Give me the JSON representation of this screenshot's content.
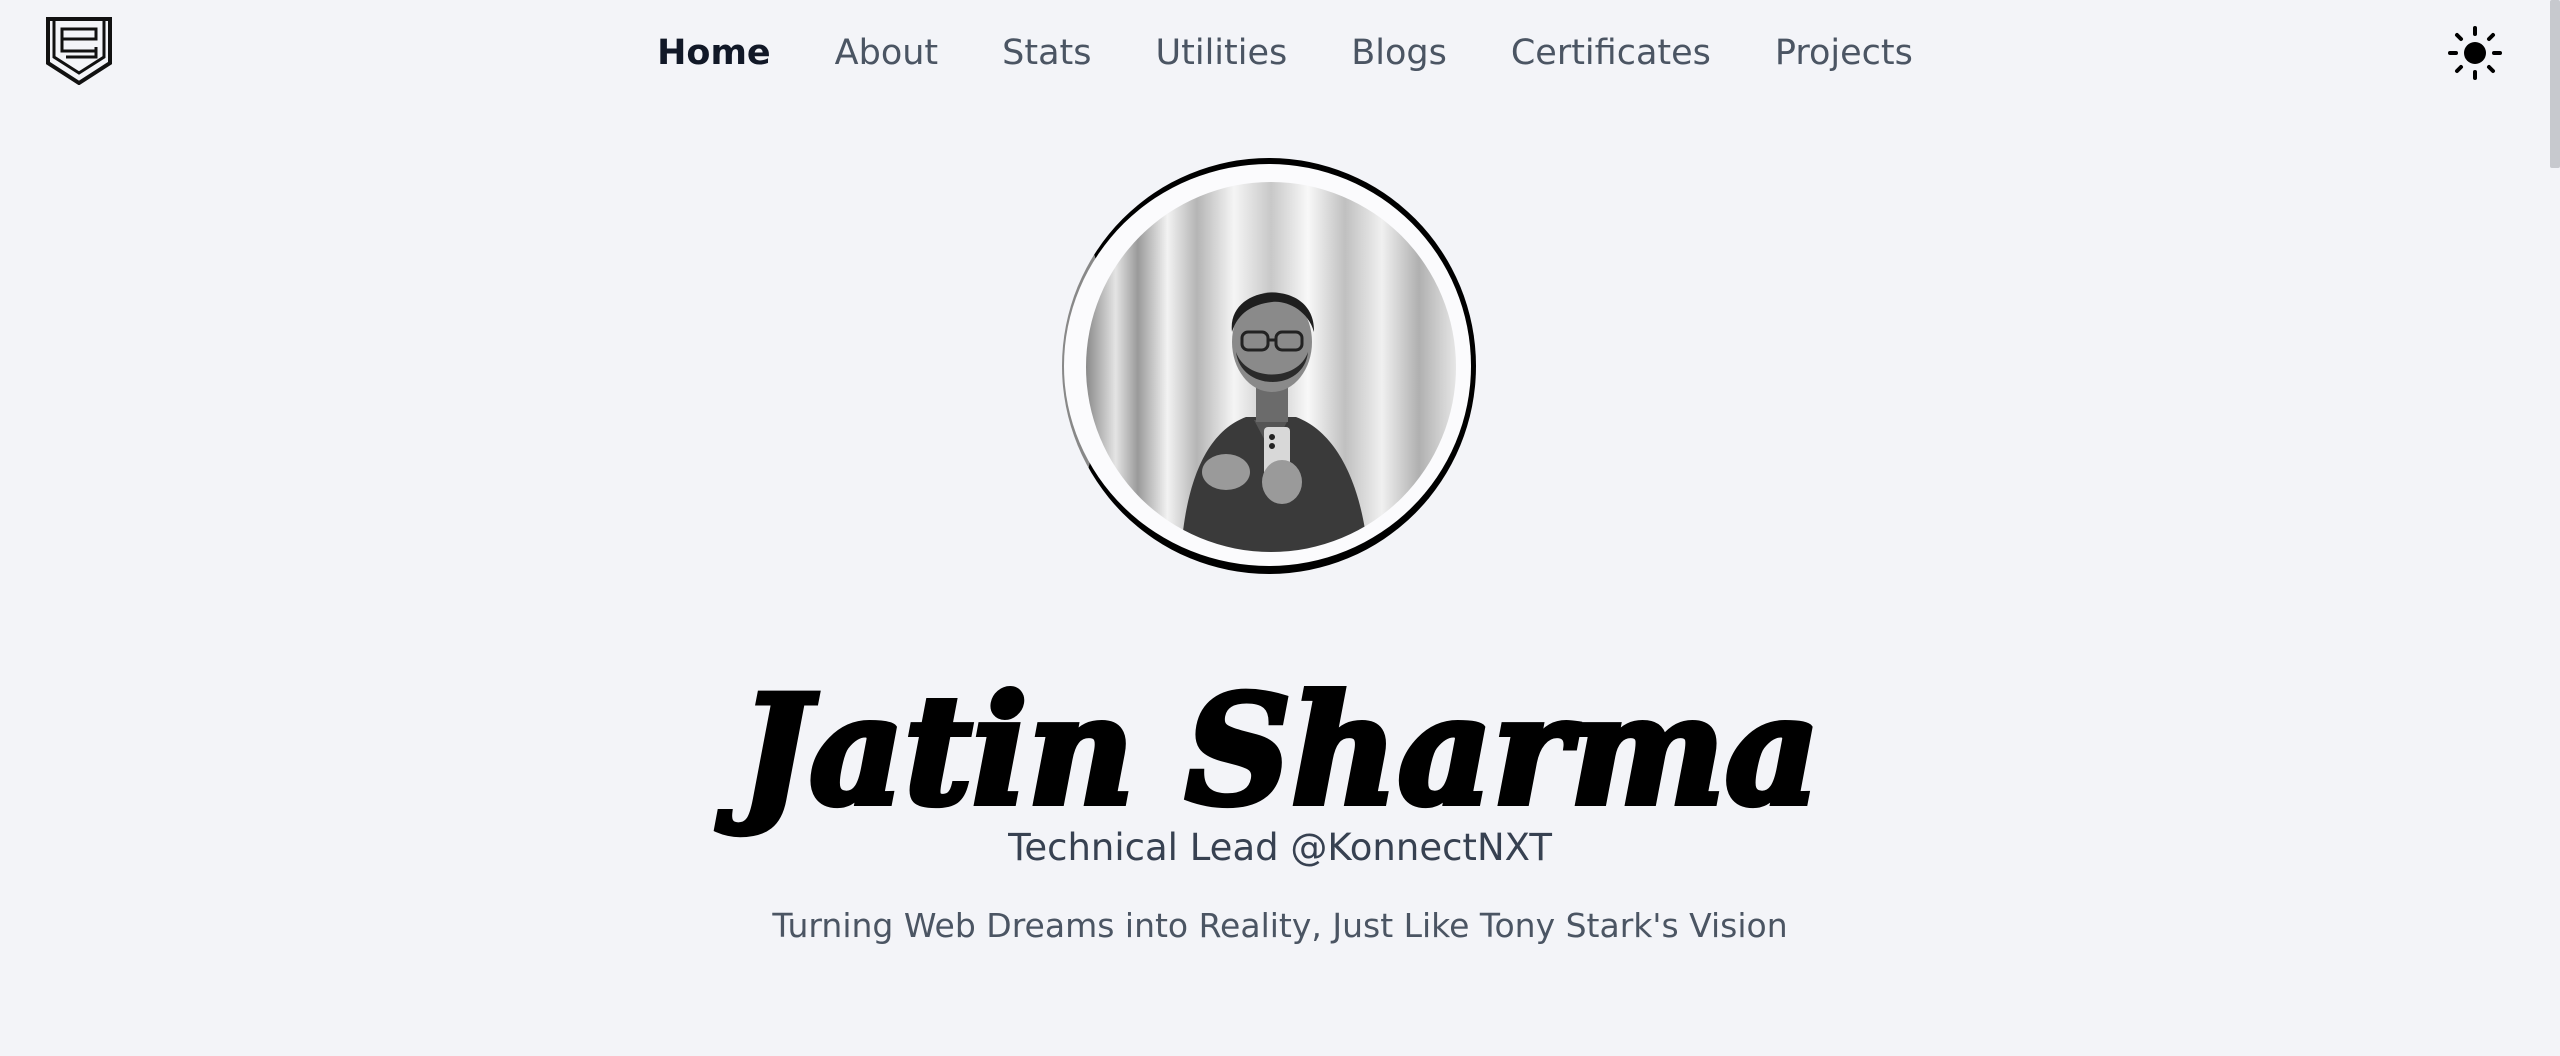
{
  "header": {
    "logo_icon": "shield-logo-icon",
    "nav": [
      {
        "label": "Home",
        "active": true
      },
      {
        "label": "About",
        "active": false
      },
      {
        "label": "Stats",
        "active": false
      },
      {
        "label": "Utilities",
        "active": false
      },
      {
        "label": "Blogs",
        "active": false
      },
      {
        "label": "Certificates",
        "active": false
      },
      {
        "label": "Projects",
        "active": false
      }
    ],
    "theme_toggle_icon": "sun-icon"
  },
  "hero": {
    "avatar_icon": "profile-photo",
    "name": "Jatin Sharma",
    "role": "Technical Lead @KonnectNXT",
    "tagline": "Turning Web Dreams into Reality, Just Like Tony Stark's Vision"
  },
  "colors": {
    "background": "#f3f4f8",
    "text_primary": "#111827",
    "text_secondary": "#4b5563"
  }
}
